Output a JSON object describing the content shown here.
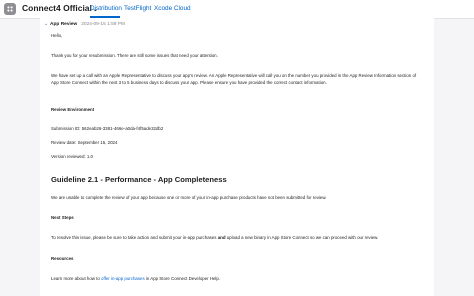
{
  "header": {
    "app_title": "Connect4 Official",
    "tabs": [
      {
        "label": "Distribution",
        "active": true
      },
      {
        "label": "TestFlight",
        "active": false
      },
      {
        "label": "Xcode Cloud",
        "active": false
      }
    ]
  },
  "message": {
    "sender": "App Review",
    "date": "2024-09-15 1:59 PM",
    "greeting": "Hello,",
    "p1": "Thank you for your resubmission. There are still some issues that need your attention.",
    "p2_line1": "We have set up a call with an Apple Representative to discuss your app's review. An Apple Representative will call you on the number you provided in the App Review Information section of",
    "p2_line2": "App Store Connect within the next 3 to 5 business days to discuss your app. Please ensure you have provided the correct contact information.",
    "review_env_heading": "Review Environment",
    "submission_id": "Submission ID: 562eab26-3381-466e-a0da-f4f5ade32db2",
    "review_date": "Review date: September 15, 2024",
    "version_reviewed": "Version reviewed: 1.0",
    "guideline_title": "Guideline 2.1 - Performance - App Completeness",
    "guideline_body": "We are unable to complete the review of your app because one or more of your in-app purchase products have not been submitted for review.",
    "next_steps_heading": "Next Steps",
    "next_steps_a": "To resolve this issue, please be sure to take action and submit your in-app purchases ",
    "next_steps_bold": "and",
    "next_steps_b": " upload a new binary in App Store Connect so we can proceed with our review.",
    "resources_heading": "Resources",
    "resources_a": "Learn more about how to ",
    "resources_link": "offer in-app purchases",
    "resources_b": " in App Store Connect Developer Help."
  },
  "colors": {
    "accent": "#0066cc",
    "background": "#f5f5f7",
    "card": "#ffffff"
  }
}
